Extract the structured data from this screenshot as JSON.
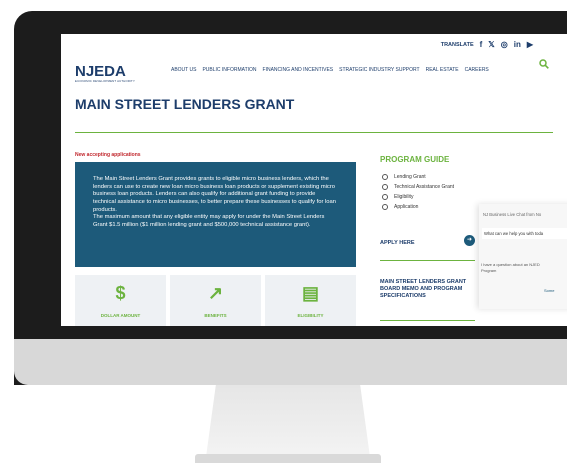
{
  "header": {
    "translate": "TRANSLATE",
    "social_icons": [
      "facebook-icon",
      "x-icon",
      "instagram-icon",
      "linkedin-icon",
      "youtube-icon"
    ],
    "social_glyphs": [
      "f",
      "𝕏",
      "◎",
      "in",
      "▶"
    ],
    "logo_text": "NJEDA",
    "logo_tagline": "ECONOMIC DEVELOPMENT AUTHORITY",
    "nav": [
      "ABOUT US",
      "PUBLIC INFORMATION",
      "FINANCING AND INCENTIVES",
      "STRATEGIC INDUSTRY SUPPORT",
      "REAL ESTATE",
      "CAREERS"
    ]
  },
  "page": {
    "title": "MAIN STREET LENDERS GRANT",
    "status": "New accepting applications",
    "description_1": "The Main Street Lenders Grant provides grants to eligible micro business lenders, which the lenders can use to create new loan micro business loan products or supplement existing micro business loan products. Lenders can also qualify for additional grant funding to provide technical assistance to micro businesses, to better prepare these businesses to qualify for loan products.",
    "description_2": "The maximum amount that any eligible entity may apply for under the Main Street Lenders Grant $1.5 million ($1 million lending grant and $500,000 technical assistance grant).",
    "cards": [
      {
        "label": "DOLLAR AMOUNT",
        "icon": "dollar-icon",
        "glyph": "$"
      },
      {
        "label": "BENEFITS",
        "icon": "trend-up-icon",
        "glyph": "↗"
      },
      {
        "label": "ELIGIBILITY",
        "icon": "clipboard-icon",
        "glyph": "▤"
      }
    ]
  },
  "sidebar": {
    "guide_title": "PROGRAM GUIDE",
    "guide_items": [
      "Lending Grant",
      "Technical Assistance Grant",
      "Eligibility",
      "Application"
    ],
    "apply": "APPLY HERE",
    "memo": "MAIN STREET LENDERS GRANT BOARD MEMO AND PROGRAM SPECIFICATIONS"
  },
  "chat": {
    "title": "NJ Business Live Chat from No",
    "question": "What can we help you with toda",
    "line_1": "I have a question about an NJED",
    "line_2": "Program",
    "something": "Some"
  },
  "colors": {
    "navy": "#1d3d6b",
    "green": "#6cb33f",
    "teal_box": "#1d5a7a",
    "red": "#c1272d"
  }
}
